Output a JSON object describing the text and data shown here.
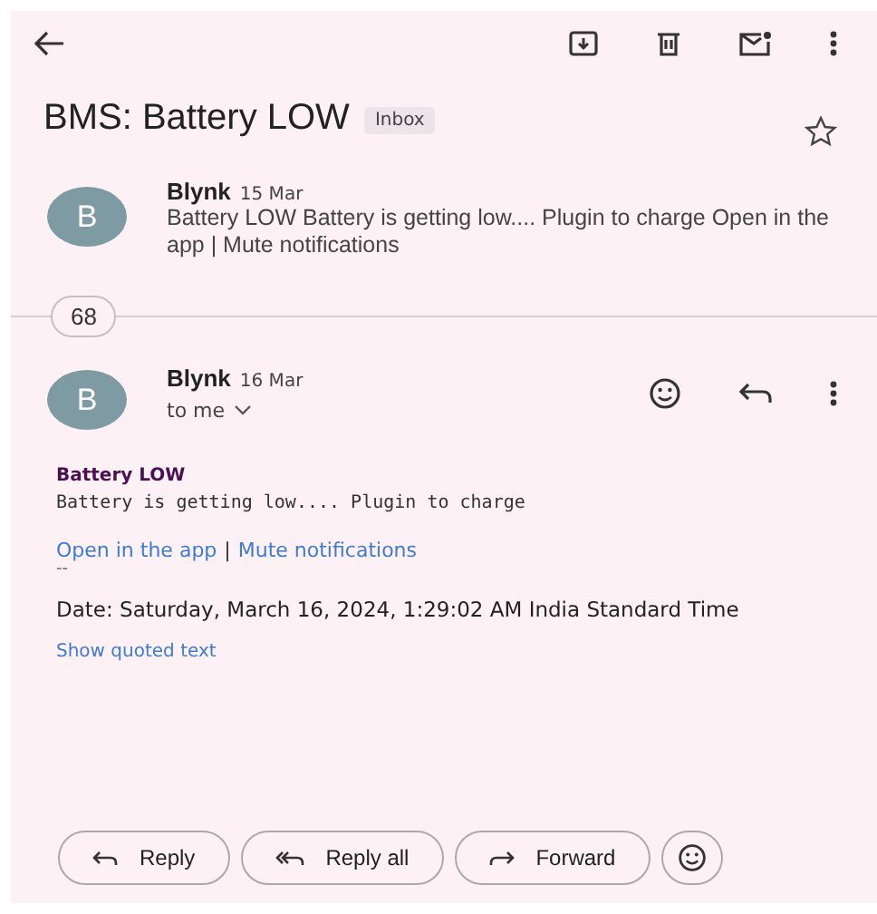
{
  "subject": "BMS: Battery LOW",
  "label": "Inbox",
  "starred": false,
  "collapsed_message": {
    "avatar": "B",
    "sender": "Blynk",
    "date": "15 Mar",
    "snippet": "Battery LOW Battery is getting low.... Plugin to charge Open in the app | Mute notifications"
  },
  "hidden_count": "68",
  "message": {
    "avatar": "B",
    "sender": "Blynk",
    "date": "16 Mar",
    "recipient": "to me",
    "heading": "Battery LOW",
    "body": "Battery is getting low.... Plugin to charge",
    "links": [
      "Open in the app",
      "Mute notifications"
    ],
    "separator": "|",
    "signature": "--",
    "footer": "Date: Saturday, March 16, 2024, 1:29:02 AM India Standard Time",
    "show_quoted": "Show quoted text"
  },
  "actions": [
    {
      "label": "Reply",
      "kind": "reply"
    },
    {
      "label": "Reply all",
      "kind": "reply_all"
    },
    {
      "label": "Forward",
      "kind": "forward"
    }
  ]
}
